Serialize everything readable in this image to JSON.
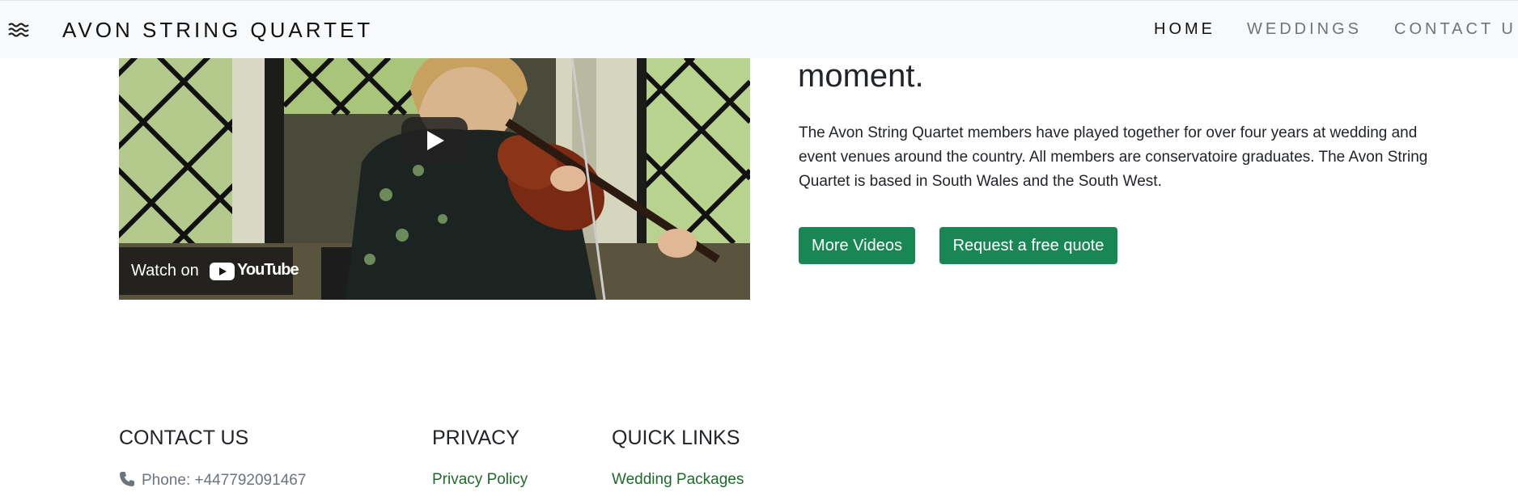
{
  "navbar": {
    "menu_icon": "hamburger-waves-icon",
    "brand": "AVON STRING QUARTET",
    "links": [
      {
        "label": "HOME",
        "active": true
      },
      {
        "label": "WEDDINGS",
        "active": false
      },
      {
        "label": "CONTACT U",
        "active": false
      }
    ]
  },
  "video": {
    "play_icon": "play-icon",
    "watch_on_label": "Watch on",
    "youtube_label": "YouTube",
    "youtube_icon": "youtube-icon"
  },
  "content": {
    "heading": "moment.",
    "description": "The Avon String Quartet members have played together for over four years at wedding and event venues around the country. All members are conservatoire graduates. The Avon String Quartet is based in South Wales and the South West.",
    "buttons": {
      "more_videos": "More Videos",
      "quote": "Request a free quote"
    }
  },
  "footer": {
    "contact": {
      "heading": "CONTACT US",
      "phone_icon": "phone-icon",
      "phone": "Phone: +447792091467"
    },
    "privacy": {
      "heading": "PRIVACY",
      "link": "Privacy Policy"
    },
    "quick_links": {
      "heading": "QUICK LINKS",
      "link": "Wedding Packages"
    }
  },
  "colors": {
    "accent": "#198754",
    "navbar_bg": "#f8f9fa",
    "link": "#1f6b2a",
    "muted": "#6c757d"
  }
}
